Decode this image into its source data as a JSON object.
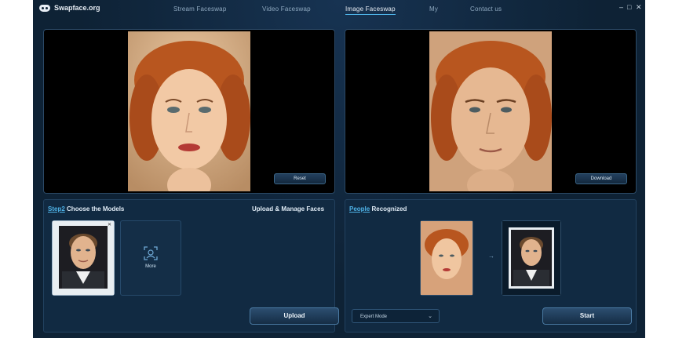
{
  "app": {
    "title": "Swapface.org"
  },
  "nav": {
    "items": [
      {
        "label": "Stream Faceswap"
      },
      {
        "label": "Video Faceswap"
      },
      {
        "label": "Image Faceswap"
      },
      {
        "label": "My"
      },
      {
        "label": "Contact us"
      }
    ],
    "active": "Image Faceswap"
  },
  "window_controls": {
    "minimize": "–",
    "maximize": "□",
    "close": "✕"
  },
  "preview": {
    "source_button": "Reset",
    "result_button": "Download"
  },
  "models": {
    "step_label": "Step2",
    "title": "Choose the Models",
    "manage_label": "Upload & Manage Faces",
    "more_label": "More",
    "upload_button": "Upload"
  },
  "people": {
    "step_label": "People",
    "title": "Recognized",
    "arrow": "→",
    "mode_select": "Expert Mode",
    "start_button": "Start"
  },
  "colors": {
    "accent": "#4fb3e8",
    "background": "#0e2235"
  }
}
